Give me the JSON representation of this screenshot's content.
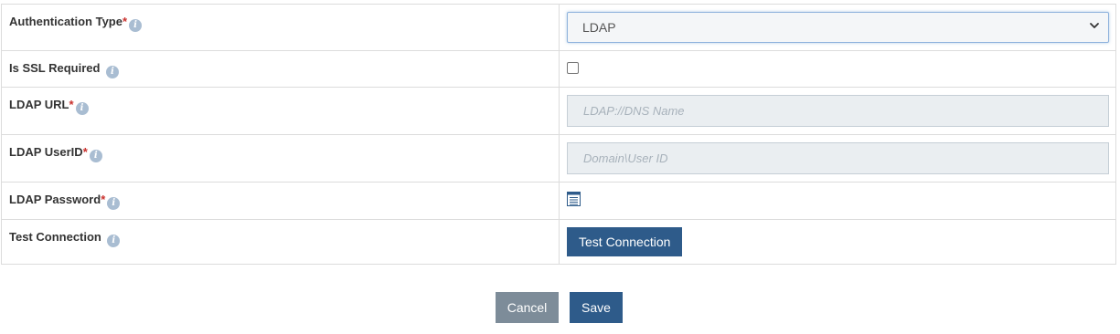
{
  "form": {
    "rows": [
      {
        "label": "Authentication Type",
        "required": true
      },
      {
        "label": "Is SSL Required",
        "required": false
      },
      {
        "label": "LDAP URL",
        "required": true
      },
      {
        "label": "LDAP UserID",
        "required": true
      },
      {
        "label": "LDAP Password",
        "required": true
      },
      {
        "label": "Test Connection",
        "required": false
      }
    ],
    "required_mark": "*",
    "info_glyph": "i",
    "auth_type_selected": "LDAP",
    "ssl_checked": false,
    "ldap_url": {
      "value": "",
      "placeholder": "LDAP://DNS Name"
    },
    "ldap_userid": {
      "value": "",
      "placeholder": "Domain\\User ID"
    },
    "password_icon": "password-field-icon",
    "test_connection_button": "Test Connection"
  },
  "actions": {
    "cancel": "Cancel",
    "save": "Save"
  },
  "colors": {
    "primary": "#2e5b8a",
    "cancel": "#7d8c99",
    "required": "#c9302c",
    "info_icon": "#a9bdd2"
  }
}
